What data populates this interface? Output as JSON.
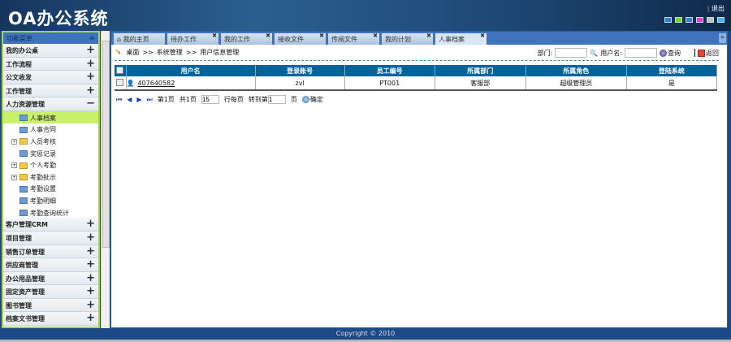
{
  "header": {
    "logo": "OA办公系统",
    "logout": "退出",
    "skin_colors": [
      "#2a7fe0",
      "#7cd420",
      "#2a7fe0",
      "#e040c0",
      "#c0c0c0",
      "#40b8f0"
    ]
  },
  "sidebar": {
    "title": "功能菜单",
    "collapse": "«",
    "groups_top": [
      {
        "label": "我的办公桌"
      },
      {
        "label": "工作流程"
      },
      {
        "label": "公文收发"
      },
      {
        "label": "工作管理"
      }
    ],
    "open_group": {
      "label": "人力资源管理",
      "items": [
        {
          "label": "人事档案",
          "type": "page",
          "active": true
        },
        {
          "label": "人事合同",
          "type": "page"
        },
        {
          "label": "人员考核",
          "type": "folder"
        },
        {
          "label": "奖惩记录",
          "type": "page"
        },
        {
          "label": "个人考勤",
          "type": "folder"
        },
        {
          "label": "考勤批示",
          "type": "folder"
        },
        {
          "label": "考勤设置",
          "type": "page"
        },
        {
          "label": "考勤明细",
          "type": "page"
        },
        {
          "label": "考勤查询统计",
          "type": "page"
        }
      ]
    },
    "groups_bottom": [
      {
        "label": "客户管理CRM"
      },
      {
        "label": "项目管理"
      },
      {
        "label": "销售订单管理"
      },
      {
        "label": "供应商管理"
      },
      {
        "label": "办公用品管理"
      },
      {
        "label": "固定资产管理"
      },
      {
        "label": "图书管理"
      },
      {
        "label": "档案文书管理"
      }
    ]
  },
  "tabs": [
    {
      "label": "我的主页",
      "home": true
    },
    {
      "label": "待办工作"
    },
    {
      "label": "我的工作"
    },
    {
      "label": "接收文件"
    },
    {
      "label": "传阅文件"
    },
    {
      "label": "我的计划"
    },
    {
      "label": "人事档案",
      "active": true
    }
  ],
  "breadcrumb": [
    "桌面",
    ">>",
    "系统管理",
    ">>",
    "用户信息管理"
  ],
  "filter": {
    "dept_label": "部门:",
    "dept_value": "",
    "user_label": "用户名:",
    "user_value": "",
    "search": "查询",
    "back": "返回"
  },
  "table": {
    "columns": [
      "用户名",
      "登录账号",
      "员工编号",
      "所属部门",
      "所属角色",
      "登陆系统"
    ],
    "rows": [
      [
        "407640582",
        "zvl",
        "PT001",
        "客服部",
        "超级管理员",
        "是"
      ]
    ]
  },
  "pager": {
    "page": "第1页",
    "total": "共1页",
    "per_page": "15",
    "per_page_label": "行每页",
    "goto_label": "转到第",
    "goto_value": "1",
    "page_unit": "页",
    "confirm": "确定"
  },
  "footer": "Copyright © 2010"
}
